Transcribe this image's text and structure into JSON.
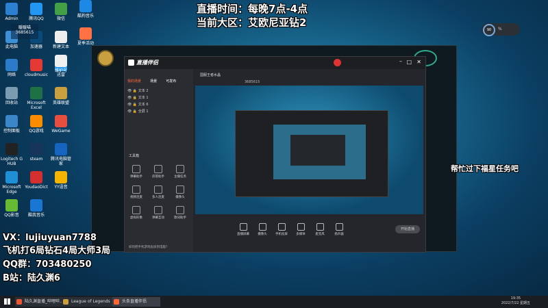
{
  "header": {
    "line1": "直播时间：每晚7点-4点",
    "line2": "当前大区：艾欧尼亚钻2"
  },
  "user_badge": {
    "name": "暖暖喵",
    "id": "3685615"
  },
  "desktop_icons": [
    {
      "label": "Admin",
      "color": "#2d7fd1"
    },
    {
      "label": "此电脑",
      "color": "#3d8fd6"
    },
    {
      "label": "网络",
      "color": "#2c7bc8"
    },
    {
      "label": "回收站",
      "color": "#7a9bb0"
    },
    {
      "label": "控制面板",
      "color": "#3b86c9"
    },
    {
      "label": "Logitech G HUB",
      "color": "#222222"
    },
    {
      "label": "Microsoft Edge",
      "color": "#1f8fd6"
    },
    {
      "label": "QQ影音",
      "color": "#66bb33"
    },
    {
      "label": "酷狗音乐",
      "color": "#1e88e5"
    },
    {
      "label": "腾讯QQ",
      "color": "#2196f3"
    },
    {
      "label": "加速器",
      "color": "#0a4a7a"
    },
    {
      "label": "cloudmusic",
      "color": "#e53935"
    },
    {
      "label": "Microsoft Excel",
      "color": "#1e7145"
    },
    {
      "label": "QQ游戏",
      "color": "#fb8c00"
    },
    {
      "label": "steam",
      "color": "#17355a"
    },
    {
      "label": "YoudaoDict",
      "color": "#d32f2f"
    },
    {
      "label": "酷我音乐",
      "color": "#1976d2"
    },
    {
      "label": "微信",
      "color": "#43a047"
    },
    {
      "label": "新建文本",
      "color": "#eeeeee"
    },
    {
      "label": "迅雷",
      "color": "#2196f3"
    },
    {
      "label": "英雄联盟",
      "color": "#c8a040"
    },
    {
      "label": "WeGame",
      "color": "#e84e40"
    },
    {
      "label": "腾讯电脑管家",
      "color": "#1565c0"
    },
    {
      "label": "YY语音",
      "color": "#f5b400"
    },
    {
      "label": "维护号",
      "color": "#f0f0f0"
    },
    {
      "label": "夏季活动",
      "color": "#ff7043"
    }
  ],
  "side_overlay": "帮忙过下福星任务吧",
  "contacts": [
    "VX：lujiuyuan7788",
    "飞机打6局钻石4局大师3局",
    "QQ群：703480250",
    "B站：陆久渊6"
  ],
  "perf_widget": {
    "value": "90",
    "unit": "%"
  },
  "app": {
    "title": "直播伴侣",
    "tabs": [
      "我的场景",
      "场景",
      "可发布"
    ],
    "sources": [
      "文本 2",
      "文本 1",
      "文本 6",
      "全屏 1"
    ],
    "tools_title": "工具箱",
    "tools": [
      "弹幕助手",
      "房管助手",
      "主播任务",
      "视频连麦",
      "多人连麦",
      "摄像头",
      "虚拟形象",
      "弹幕互动",
      "歌词助手"
    ],
    "stream_title": "国服王者水晶",
    "user_id": "3685615",
    "bottom_tools": [
      "直播屏幕",
      "摄像头",
      "手机投屏",
      "多媒体",
      "麦克风",
      "扬声器"
    ],
    "start_label": "开始直播",
    "footer_hint": "如何把手机游戏投屏到电脑?"
  },
  "taskbar": {
    "items": [
      "陆久渊直播_哔哩哔...",
      "League of Legends",
      "头条直播伴侣"
    ],
    "time": "19:35",
    "date": "2022/7/22 星期五"
  },
  "colors": {
    "accent": "#ff6a3d",
    "app_bg": "#25262b"
  }
}
